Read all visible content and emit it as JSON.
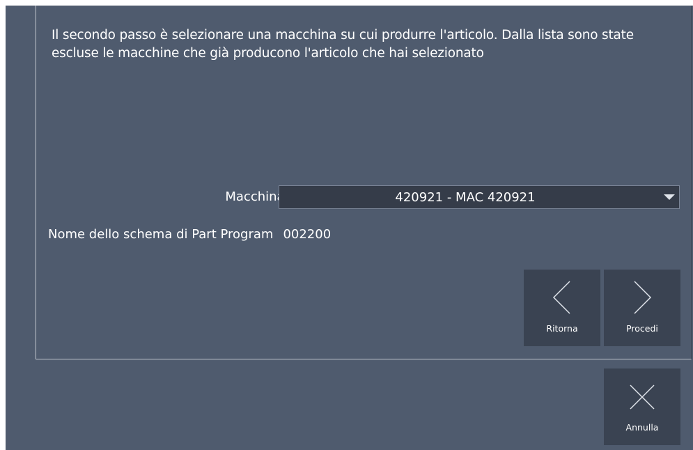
{
  "step": {
    "instructions": "Il secondo passo è selezionare una macchina su cui produrre l'articolo. Dalla lista sono state escluse le macchine che già producono l'articolo che hai selezionato"
  },
  "machine": {
    "label": "Macchinario",
    "selected": "420921 - MAC 420921"
  },
  "part_program": {
    "label": "Nome dello schema di Part Program",
    "value": "002200"
  },
  "buttons": {
    "back_label": "Ritorna",
    "back_icon": "chevron-left-icon",
    "next_label": "Procedi",
    "next_icon": "chevron-right-icon",
    "cancel_label": "Annulla",
    "cancel_icon": "close-icon"
  },
  "colors": {
    "background": "#4f5b6e",
    "tile": "#3a4352",
    "select_bg": "#353c49",
    "text": "#ffffff"
  }
}
